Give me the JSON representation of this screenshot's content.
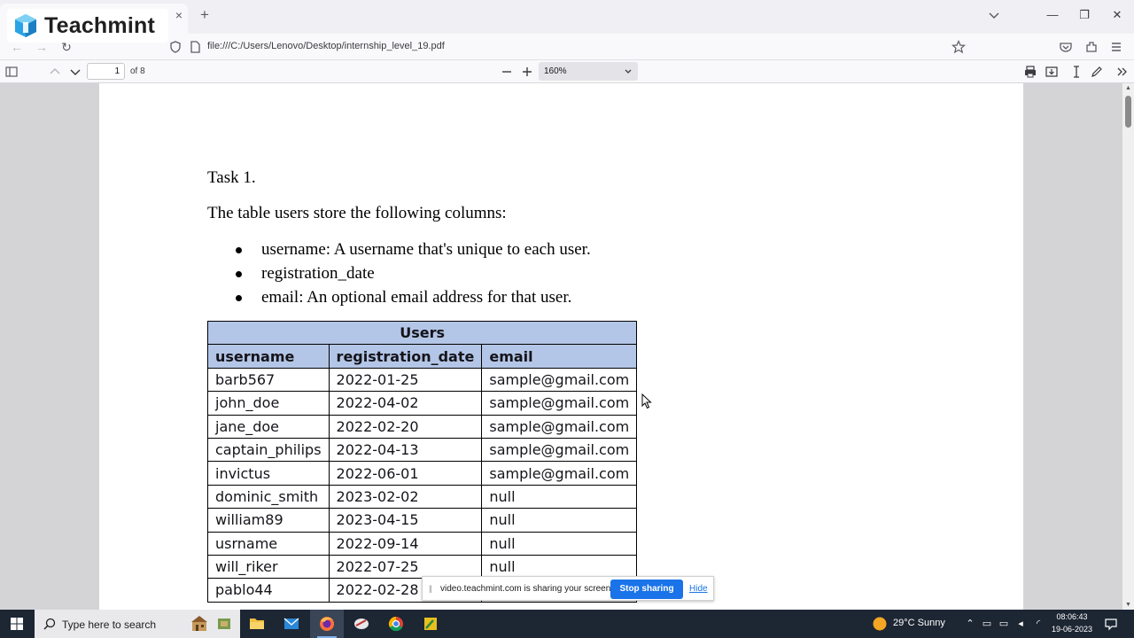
{
  "branding": {
    "logo_text": "Teachmint"
  },
  "browser": {
    "tab_close": "×",
    "new_tab": "+",
    "url": "file:///C:/Users/Lenovo/Desktop/internship_level_19.pdf",
    "window_controls": {
      "minimize": "—",
      "restore": "❐",
      "close": "✕"
    }
  },
  "pdf_toolbar": {
    "page_number": "1",
    "page_total": "of 8",
    "zoom": "160%"
  },
  "document": {
    "heading": "Task 1.",
    "intro": "The table users store the following columns:",
    "bullets": [
      "username: A username that's unique to each user.",
      "registration_date",
      "email: An optional email address for that user."
    ],
    "table": {
      "caption": "Users",
      "columns": [
        "username",
        "registration_date",
        "email"
      ],
      "rows": [
        [
          "barb567",
          "2022-01-25",
          "sample@gmail.com"
        ],
        [
          "john_doe",
          "2022-04-02",
          "sample@gmail.com"
        ],
        [
          "jane_doe",
          "2022-02-20",
          "sample@gmail.com"
        ],
        [
          "captain_philips",
          "2022-04-13",
          "sample@gmail.com"
        ],
        [
          "invictus",
          "2022-06-01",
          "sample@gmail.com"
        ],
        [
          "dominic_smith",
          "2023-02-02",
          "null"
        ],
        [
          "william89",
          "2023-04-15",
          "null"
        ],
        [
          "usrname",
          "2022-09-14",
          "null"
        ],
        [
          "will_riker",
          "2022-07-25",
          "null"
        ],
        [
          "pablo44",
          "2022-02-28",
          ""
        ]
      ]
    }
  },
  "share_bar": {
    "message": "video.teachmint.com is sharing your screen.",
    "stop_label": "Stop sharing",
    "hide_label": "Hide"
  },
  "taskbar": {
    "search_placeholder": "Type here to search",
    "weather": "29°C  Sunny",
    "time": "08:06:43",
    "date": "19-06-2023"
  },
  "colors": {
    "table_header": "#b4c6e7",
    "stop_button": "#1a73e8",
    "taskbar": "#1d2633"
  }
}
